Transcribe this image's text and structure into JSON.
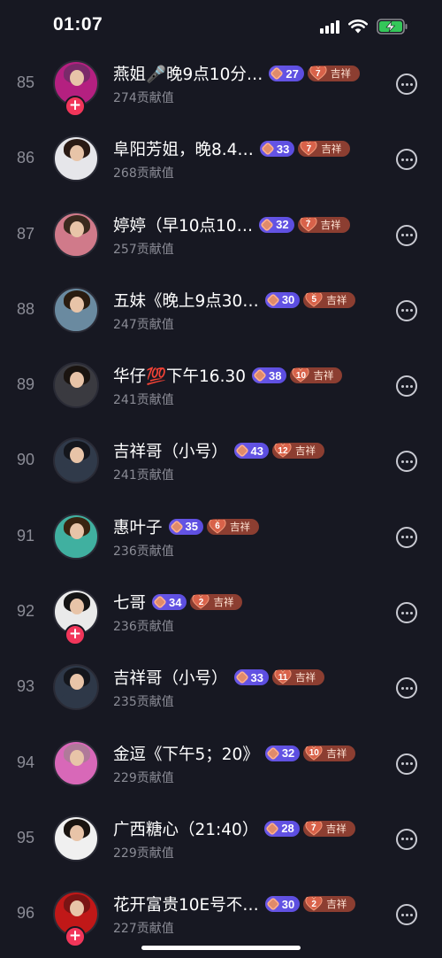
{
  "status_bar": {
    "time": "01:07"
  },
  "fan_badge_text": "吉祥",
  "contribution_suffix": "贡献值",
  "rows": [
    {
      "rank": "85",
      "name": "燕姐🎤晚9点10分…",
      "level": "27",
      "fan_level": "7",
      "contribution": "274贡献值",
      "follow": true,
      "hair": "#7a2a6a",
      "body": "#b42080"
    },
    {
      "rank": "86",
      "name": "阜阳芳姐，晚8.4…",
      "level": "33",
      "fan_level": "7",
      "contribution": "268贡献值",
      "follow": false,
      "hair": "#2a1a14",
      "body": "#e6e6ea"
    },
    {
      "rank": "87",
      "name": "婷婷（早10点10…",
      "level": "32",
      "fan_level": "7",
      "contribution": "257贡献值",
      "follow": false,
      "hair": "#3a2a1e",
      "body": "#d07a8a"
    },
    {
      "rank": "88",
      "name": "五妹《晚上9点30…",
      "level": "30",
      "fan_level": "5",
      "contribution": "247贡献值",
      "follow": false,
      "hair": "#2a1c10",
      "body": "#6a8aa0"
    },
    {
      "rank": "89",
      "name": "华仔💯下午16.30",
      "level": "38",
      "fan_level": "10",
      "contribution": "241贡献值",
      "follow": false,
      "hair": "#1a1410",
      "body": "#3a3a40"
    },
    {
      "rank": "90",
      "name": "吉祥哥（小号）",
      "level": "43",
      "fan_level": "12",
      "contribution": "241贡献值",
      "follow": false,
      "hair": "#14161c",
      "body": "#303a4a"
    },
    {
      "rank": "91",
      "name": "惠叶子",
      "level": "35",
      "fan_level": "6",
      "contribution": "236贡献值",
      "follow": false,
      "hair": "#3a2410",
      "body": "#40b0a0"
    },
    {
      "rank": "92",
      "name": "七哥",
      "level": "34",
      "fan_level": "2",
      "contribution": "236贡献值",
      "follow": true,
      "hair": "#141414",
      "body": "#eaeaea"
    },
    {
      "rank": "93",
      "name": "吉祥哥（小号）",
      "level": "33",
      "fan_level": "11",
      "contribution": "235贡献值",
      "follow": false,
      "hair": "#14161c",
      "body": "#2e3848"
    },
    {
      "rank": "94",
      "name": "金逗《下午5；20》",
      "level": "32",
      "fan_level": "10",
      "contribution": "229贡献值",
      "follow": false,
      "hair": "#b07a9a",
      "body": "#d868b8"
    },
    {
      "rank": "95",
      "name": "广西糖心（21:40）",
      "level": "28",
      "fan_level": "7",
      "contribution": "229贡献值",
      "follow": false,
      "hair": "#1a1410",
      "body": "#f0f0f0"
    },
    {
      "rank": "96",
      "name": "花开富贵10E号不…",
      "level": "30",
      "fan_level": "2",
      "contribution": "227贡献值",
      "follow": true,
      "hair": "#7a1414",
      "body": "#c01818"
    }
  ]
}
